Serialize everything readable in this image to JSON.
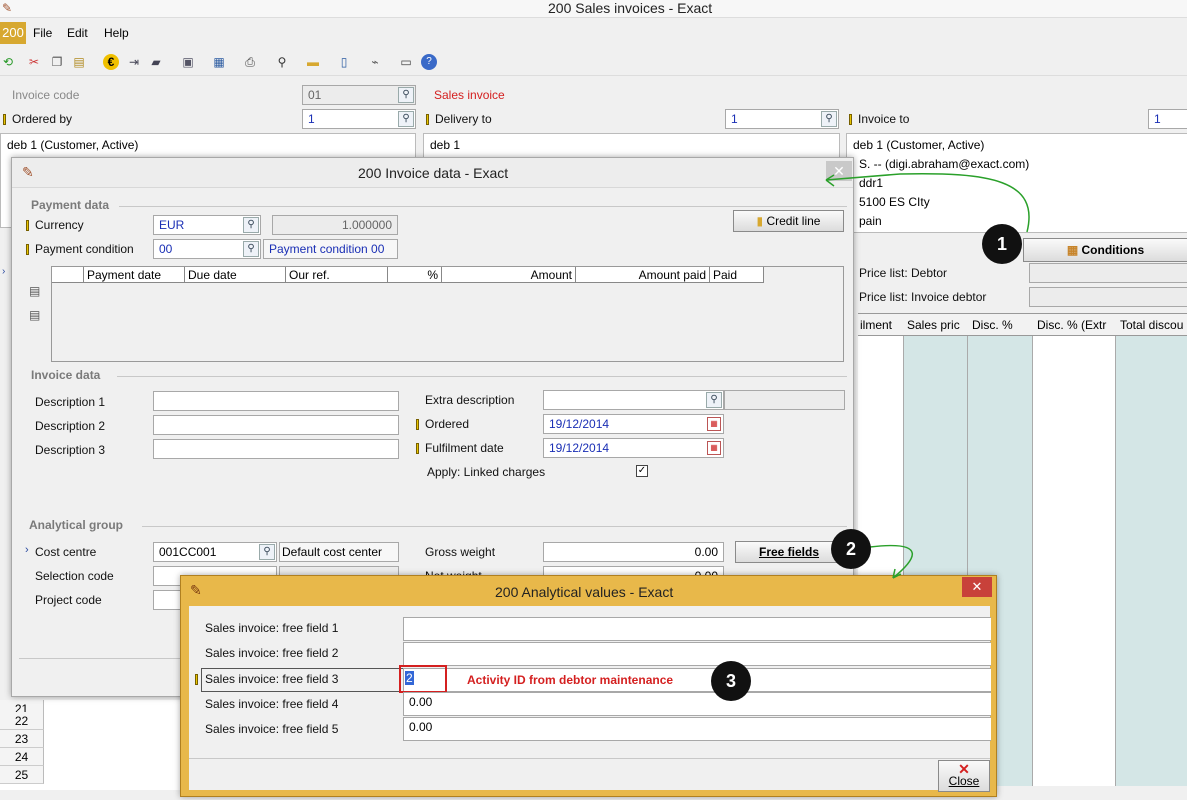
{
  "main_window": {
    "title": "200 Sales invoices - Exact",
    "company_badge": "200",
    "menu": [
      "File",
      "Edit",
      "Help"
    ],
    "invoice_code_label": "Invoice code",
    "invoice_code_value": "01",
    "sales_invoice_label": "Sales invoice",
    "ordered_by_label": "Ordered by",
    "ordered_by_value": "1",
    "delivery_to_label": "Delivery to",
    "delivery_to_value": "1",
    "invoice_to_label": "Invoice to",
    "invoice_to_value": "1",
    "ordered_by_name": "deb 1 (Customer, Active)",
    "delivery_to_name": "deb 1",
    "invoice_to_name": "deb 1 (Customer, Active)",
    "invoice_to_address": [
      "S. -- (digi.abraham@exact.com)",
      "ddr1",
      "5100  ES CIty",
      "pain"
    ],
    "conditions_button": "Conditions",
    "price_list_debtor_label": "Price list: Debtor",
    "price_list_invoice_debtor_label": "Price list: Invoice debtor",
    "grid_headers": [
      "ilment",
      "Sales pric",
      "Disc. %",
      "Disc. % (Extr",
      "Total discou"
    ],
    "row_numbers": [
      "21",
      "22",
      "23",
      "24",
      "25"
    ]
  },
  "invoice_dialog": {
    "title": "200 Invoice data - Exact",
    "payment_section": "Payment data",
    "currency_label": "Currency",
    "currency_value": "EUR",
    "rate_value": "1.000000",
    "credit_line_button": "Credit line",
    "payment_condition_label": "Payment condition",
    "payment_condition_value": "00",
    "payment_condition_desc": "Payment condition 00",
    "table_headers": [
      "Payment date",
      "Due date",
      "Our ref.",
      "%",
      "Amount",
      "Amount paid",
      "Paid"
    ],
    "invoice_section": "Invoice data",
    "description1_label": "Description 1",
    "description2_label": "Description 2",
    "description3_label": "Description 3",
    "extra_description_label": "Extra description",
    "ordered_label": "Ordered",
    "ordered_value": "19/12/2014",
    "fulfilment_label": "Fulfilment date",
    "fulfilment_value": "19/12/2014",
    "linked_charges_label": "Apply: Linked charges",
    "analytical_section": "Analytical group",
    "cost_centre_label": "Cost centre",
    "cost_centre_value": "001CC001",
    "cost_centre_desc": "Default cost center",
    "selection_code_label": "Selection code",
    "project_code_label": "Project code",
    "gross_weight_label": "Gross weight",
    "gross_weight_value": "0.00",
    "net_weight_label": "Net weight",
    "net_weight_value": "0.00",
    "free_fields_button": "Free fields"
  },
  "analytical_dialog": {
    "title": "200 Analytical values - Exact",
    "fields": [
      {
        "label": "Sales invoice: free field 1",
        "value": ""
      },
      {
        "label": "Sales invoice: free field 2",
        "value": ""
      },
      {
        "label": "Sales invoice: free field 3",
        "value": "2"
      },
      {
        "label": "Sales invoice: free field 4",
        "value": "0.00"
      },
      {
        "label": "Sales invoice: free field 5",
        "value": "0.00"
      }
    ],
    "close_button": "Close"
  },
  "annotations": {
    "step1": "1",
    "step2": "2",
    "step3": "3",
    "note3": "Activity ID from debtor maintenance",
    "accent": "#d42020",
    "arrow_color": "#2aa02a"
  }
}
